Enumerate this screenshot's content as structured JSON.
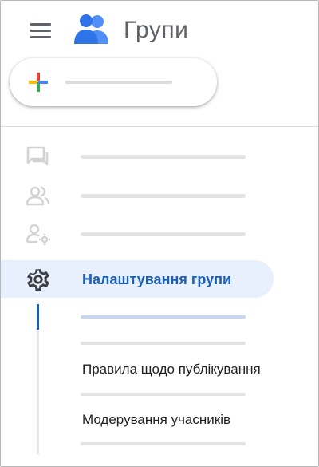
{
  "header": {
    "app_title": "Групи",
    "menu_icon": "hamburger-menu-icon",
    "logo_icon": "groups-people-icon"
  },
  "new_button": {
    "icon": "plus-icon",
    "colors": [
      "#ea4335",
      "#fbbc04",
      "#34a853",
      "#4285f4"
    ]
  },
  "nav": {
    "items": [
      {
        "icon": "conversations-icon"
      },
      {
        "icon": "members-icon"
      },
      {
        "icon": "member-settings-icon"
      }
    ],
    "active": {
      "icon": "settings-gear-icon",
      "label": "Налаштування групи"
    },
    "sub_items": [
      {
        "label": "Правила щодо публікування"
      },
      {
        "label": "Модерування учасників"
      }
    ]
  },
  "colors": {
    "accent": "#1a5fb4",
    "active_bg": "#e8f0fe",
    "icon_gray": "#5f6368"
  }
}
